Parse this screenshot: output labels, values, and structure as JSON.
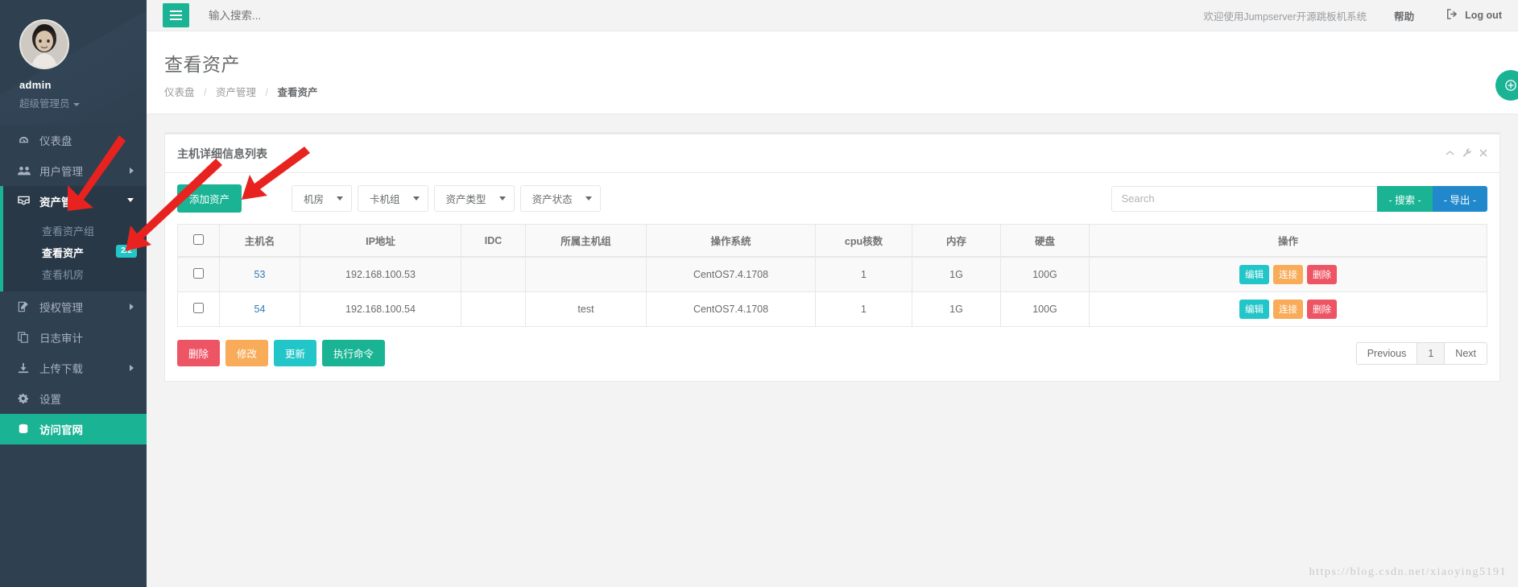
{
  "sidebar": {
    "profile": {
      "name": "admin",
      "role": "超级管理员",
      "avatar_icon": "user-avatar-photo"
    },
    "items": [
      {
        "label": "仪表盘",
        "icon": "dashboard-icon",
        "has_children": false
      },
      {
        "label": "用户管理",
        "icon": "users-icon",
        "has_children": true
      },
      {
        "label": "资产管理",
        "icon": "box-icon",
        "has_children": true,
        "active": true
      },
      {
        "label": "授权管理",
        "icon": "edit-square-icon",
        "has_children": true
      },
      {
        "label": "日志审计",
        "icon": "copy-icon",
        "has_children": false
      },
      {
        "label": "上传下载",
        "icon": "download-icon",
        "has_children": true
      },
      {
        "label": "设置",
        "icon": "gear-icon",
        "has_children": false
      },
      {
        "label": "访问官网",
        "icon": "database-icon",
        "has_children": false,
        "highlight": true
      }
    ],
    "submenu": [
      {
        "label": "查看资产组",
        "selected": false
      },
      {
        "label": "查看资产",
        "selected": true,
        "badge": "2/2"
      },
      {
        "label": "查看机房",
        "selected": false
      }
    ]
  },
  "topbar": {
    "menu_toggle_icon": "hamburger-icon",
    "search_placeholder": "输入搜索...",
    "search_value": "",
    "welcome": "欢迎使用Jumpserver开源跳板机系统",
    "help": "帮助",
    "logout": "Log out",
    "logout_icon": "sign-out-icon"
  },
  "page": {
    "title": "查看资产",
    "breadcrumb": [
      {
        "label": "仪表盘",
        "current": false
      },
      {
        "label": "资产管理",
        "current": false
      },
      {
        "label": "查看资产",
        "current": true
      }
    ]
  },
  "panel": {
    "title": "主机详细信息列表",
    "tools": [
      "collapse-icon",
      "wrench-icon",
      "close-icon"
    ],
    "toolbar": {
      "add_label": "添加资产",
      "filters": [
        {
          "label": "机房"
        },
        {
          "label": "卡机组"
        },
        {
          "label": "资产类型"
        },
        {
          "label": "资产状态"
        }
      ],
      "search_placeholder": "Search",
      "search_value": "",
      "search_button": "- 搜索 -",
      "export_button": "- 导出 -"
    },
    "table": {
      "columns": [
        "",
        "主机名",
        "IP地址",
        "IDC",
        "所属主机组",
        "操作系统",
        "cpu核数",
        "内存",
        "硬盘",
        "操作"
      ],
      "rows": [
        {
          "checked": false,
          "hostname": "53",
          "ip": "192.168.100.53",
          "idc": "",
          "group": "",
          "os": "CentOS7.4.1708",
          "cpu": "1",
          "mem": "1G",
          "disk": "100G",
          "actions": [
            "编辑",
            "连接",
            "删除"
          ]
        },
        {
          "checked": false,
          "hostname": "54",
          "ip": "192.168.100.54",
          "idc": "",
          "group": "test",
          "os": "CentOS7.4.1708",
          "cpu": "1",
          "mem": "1G",
          "disk": "100G",
          "actions": [
            "编辑",
            "连接",
            "删除"
          ]
        }
      ]
    },
    "footer": {
      "buttons": [
        "删除",
        "修改",
        "更新",
        "执行命令"
      ],
      "pager": {
        "previous": "Previous",
        "page": "1",
        "next": "Next"
      }
    }
  },
  "watermark": "https://blog.csdn.net/xiaoying5191",
  "colors": {
    "sidebar_bg": "#2f4050",
    "sidebar_active_bg": "#293846",
    "accent_green": "#1ab394",
    "teal": "#23c6c8",
    "orange": "#f8ac59",
    "red": "#ed5565",
    "blue": "#2288cc",
    "link_blue": "#337ab7",
    "annotation_red": "#e8231f"
  }
}
